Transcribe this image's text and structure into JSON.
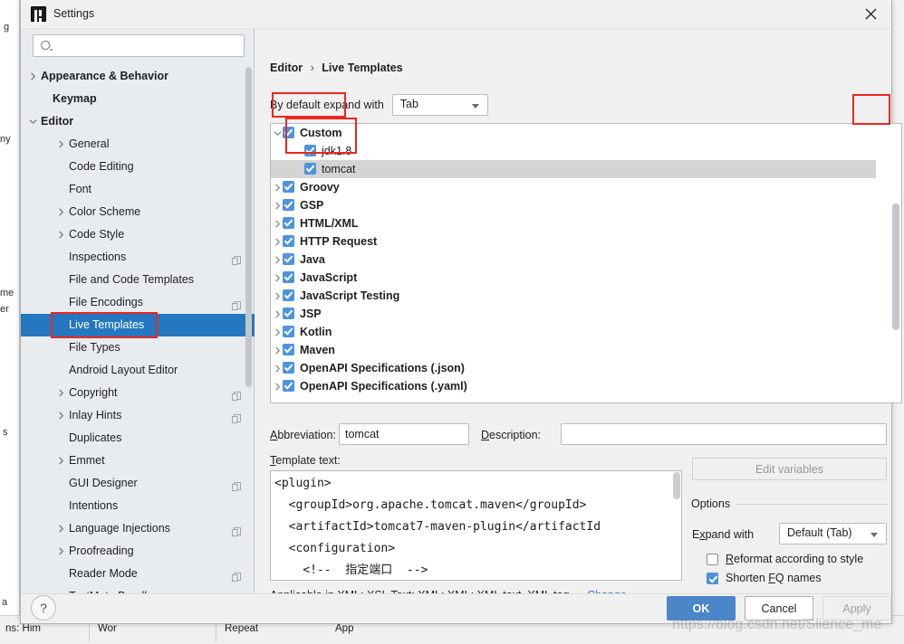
{
  "window": {
    "title": "Settings",
    "app_icon": "intellij-idea-icon",
    "close_icon": "close-icon"
  },
  "search": {
    "placeholder": "",
    "value": "",
    "icon": "search-icon"
  },
  "sidebar": {
    "items": [
      {
        "label": "Appearance & Behavior",
        "indent": 22,
        "arrow": "chevron-right",
        "bold": true,
        "selected": false,
        "copy": false
      },
      {
        "label": "Keymap",
        "indent": 35,
        "arrow": "",
        "bold": true,
        "selected": false,
        "copy": false
      },
      {
        "label": "Editor",
        "indent": 22,
        "arrow": "chevron-down",
        "bold": true,
        "selected": false,
        "copy": false
      },
      {
        "label": "General",
        "indent": 53,
        "arrow": "chevron-right",
        "bold": false,
        "selected": false,
        "copy": false
      },
      {
        "label": "Code Editing",
        "indent": 53,
        "arrow": "",
        "bold": false,
        "selected": false,
        "copy": false
      },
      {
        "label": "Font",
        "indent": 53,
        "arrow": "",
        "bold": false,
        "selected": false,
        "copy": false
      },
      {
        "label": "Color Scheme",
        "indent": 53,
        "arrow": "chevron-right",
        "bold": false,
        "selected": false,
        "copy": false
      },
      {
        "label": "Code Style",
        "indent": 53,
        "arrow": "chevron-right",
        "bold": false,
        "selected": false,
        "copy": false
      },
      {
        "label": "Inspections",
        "indent": 53,
        "arrow": "",
        "bold": false,
        "selected": false,
        "copy": true
      },
      {
        "label": "File and Code Templates",
        "indent": 53,
        "arrow": "",
        "bold": false,
        "selected": false,
        "copy": false
      },
      {
        "label": "File Encodings",
        "indent": 53,
        "arrow": "",
        "bold": false,
        "selected": false,
        "copy": true
      },
      {
        "label": "Live Templates",
        "indent": 53,
        "arrow": "",
        "bold": false,
        "selected": true,
        "copy": false
      },
      {
        "label": "File Types",
        "indent": 53,
        "arrow": "",
        "bold": false,
        "selected": false,
        "copy": false
      },
      {
        "label": "Android Layout Editor",
        "indent": 53,
        "arrow": "",
        "bold": false,
        "selected": false,
        "copy": false
      },
      {
        "label": "Copyright",
        "indent": 53,
        "arrow": "chevron-right",
        "bold": false,
        "selected": false,
        "copy": true
      },
      {
        "label": "Inlay Hints",
        "indent": 53,
        "arrow": "chevron-right",
        "bold": false,
        "selected": false,
        "copy": true
      },
      {
        "label": "Duplicates",
        "indent": 53,
        "arrow": "",
        "bold": false,
        "selected": false,
        "copy": false
      },
      {
        "label": "Emmet",
        "indent": 53,
        "arrow": "chevron-right",
        "bold": false,
        "selected": false,
        "copy": false
      },
      {
        "label": "GUI Designer",
        "indent": 53,
        "arrow": "",
        "bold": false,
        "selected": false,
        "copy": true
      },
      {
        "label": "Intentions",
        "indent": 53,
        "arrow": "",
        "bold": false,
        "selected": false,
        "copy": false
      },
      {
        "label": "Language Injections",
        "indent": 53,
        "arrow": "chevron-right",
        "bold": false,
        "selected": false,
        "copy": true
      },
      {
        "label": "Proofreading",
        "indent": 53,
        "arrow": "chevron-right",
        "bold": false,
        "selected": false,
        "copy": false
      },
      {
        "label": "Reader Mode",
        "indent": 53,
        "arrow": "",
        "bold": false,
        "selected": false,
        "copy": true
      },
      {
        "label": "TextMate Bundles",
        "indent": 53,
        "arrow": "",
        "bold": false,
        "selected": false,
        "copy": false
      }
    ]
  },
  "breadcrumb": {
    "parent": "Editor",
    "separator": "›",
    "current": "Live Templates"
  },
  "expand_with": {
    "label": "By default expand with",
    "value": "Tab"
  },
  "templates": [
    {
      "label": "Custom",
      "indent": 13,
      "arrow": "chevron-down",
      "bold": true,
      "checked": true,
      "highlight": false
    },
    {
      "label": "jdk1.8",
      "indent": 37,
      "arrow": "",
      "bold": false,
      "checked": true,
      "highlight": false
    },
    {
      "label": "tomcat",
      "indent": 37,
      "arrow": "",
      "bold": false,
      "checked": true,
      "highlight": true
    },
    {
      "label": "Groovy",
      "indent": 13,
      "arrow": "chevron-right",
      "bold": true,
      "checked": true,
      "highlight": false
    },
    {
      "label": "GSP",
      "indent": 13,
      "arrow": "chevron-right",
      "bold": true,
      "checked": true,
      "highlight": false
    },
    {
      "label": "HTML/XML",
      "indent": 13,
      "arrow": "chevron-right",
      "bold": true,
      "checked": true,
      "highlight": false
    },
    {
      "label": "HTTP Request",
      "indent": 13,
      "arrow": "chevron-right",
      "bold": true,
      "checked": true,
      "highlight": false
    },
    {
      "label": "Java",
      "indent": 13,
      "arrow": "chevron-right",
      "bold": true,
      "checked": true,
      "highlight": false
    },
    {
      "label": "JavaScript",
      "indent": 13,
      "arrow": "chevron-right",
      "bold": true,
      "checked": true,
      "highlight": false
    },
    {
      "label": "JavaScript Testing",
      "indent": 13,
      "arrow": "chevron-right",
      "bold": true,
      "checked": true,
      "highlight": false
    },
    {
      "label": "JSP",
      "indent": 13,
      "arrow": "chevron-right",
      "bold": true,
      "checked": true,
      "highlight": false
    },
    {
      "label": "Kotlin",
      "indent": 13,
      "arrow": "chevron-right",
      "bold": true,
      "checked": true,
      "highlight": false
    },
    {
      "label": "Maven",
      "indent": 13,
      "arrow": "chevron-right",
      "bold": true,
      "checked": true,
      "highlight": false
    },
    {
      "label": "OpenAPI Specifications (.json)",
      "indent": 13,
      "arrow": "chevron-right",
      "bold": true,
      "checked": true,
      "highlight": false
    },
    {
      "label": "OpenAPI Specifications (.yaml)",
      "indent": 13,
      "arrow": "chevron-right",
      "bold": true,
      "checked": true,
      "highlight": false
    }
  ],
  "toolbar": {
    "add": "+",
    "add_icon": "plus-icon",
    "remove": "−",
    "remove_icon": "minus-icon",
    "duplicate_icon": "copy-icon",
    "revert_icon": "revert-arrow-icon"
  },
  "details": {
    "abbreviation_label": "Abbreviation:",
    "abbreviation_value": "tomcat",
    "description_label": "Description:",
    "description_value": "",
    "template_text_label": "Template text:",
    "template_text": "<plugin>\n  <groupId>org.apache.tomcat.maven</groupId>\n  <artifactId>tomcat7-maven-plugin</artifactId\n  <configuration>\n    <!--  指定端口  -->",
    "edit_variables_label": "Edit variables"
  },
  "options": {
    "title": "Options",
    "expand_with_label": "Expand with",
    "expand_with_value": "Default (Tab)",
    "reformat_label": "Reformat according to style",
    "reformat_checked": false,
    "shorten_label": "Shorten FQ names",
    "shorten_checked": true
  },
  "applicable": {
    "text": "Applicable in XML: XSL Text; XML; XML: XML text, XML tag.",
    "change_label": "Change"
  },
  "footer": {
    "help_label": "?",
    "ok_label": "OK",
    "cancel_label": "Cancel",
    "apply_label": "Apply"
  },
  "watermark": "https://blog.csdn.net/Slience_me",
  "background": {
    "left_fragments": [
      "g",
      "ny",
      "me",
      "er",
      "s",
      "a"
    ],
    "bottom_fragments": [
      "ns:  Him",
      "Wor",
      "Repeat",
      "App"
    ]
  },
  "colors": {
    "selection_blue": "#2577c0",
    "checkbox_blue": "#4d94dd",
    "ok_button_blue": "#4a86c8",
    "annotation_red": "#e8281e",
    "link_blue": "#3a78b8"
  }
}
